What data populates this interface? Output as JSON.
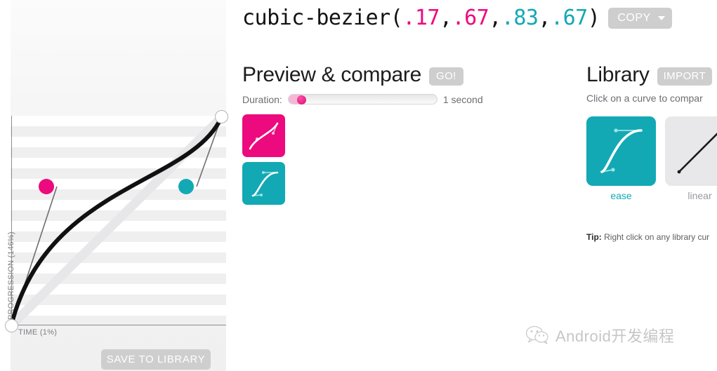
{
  "expression": {
    "prefix": "cubic-bezier(",
    "p1x": ".17",
    "sep1": ",",
    "p1y": ".67",
    "sep2": ",",
    "p2x": ".83",
    "sep3": ",",
    "p2y": ".67",
    "suffix": ")",
    "copy_label": "COPY",
    "caret_icon": "chevron-down-icon"
  },
  "editor": {
    "y_axis_label": "PROGRESSION (146%)",
    "x_axis_label": "TIME (1%)",
    "save_label": "SAVE TO LIBRARY",
    "handle1_color": "#ec0a7e",
    "handle2_color": "#12a9b4",
    "curve_color": "#111111",
    "ghost_curve_color": "#e4e4e6"
  },
  "preview": {
    "title": "Preview & compare",
    "go_label": "GO!",
    "duration_label": "Duration:",
    "duration_value": "1 second",
    "duration_percent": 8,
    "swatch_current_color": "#ec0a7e",
    "swatch_compare_color": "#12a9b4"
  },
  "library": {
    "title": "Library",
    "import_label": "IMPORT",
    "subtitle": "Click on a curve to compar",
    "tip_prefix": "Tip:",
    "tip_text": " Right click on any library cur",
    "items": [
      {
        "label": "ease",
        "selected": true,
        "thumb_bg": "#12a9b4",
        "curve_color": "#ffffff"
      },
      {
        "label": "linear",
        "selected": false,
        "thumb_bg": "#e8e8ea",
        "curve_color": "#1b1b1b"
      }
    ]
  },
  "watermark": {
    "icon": "wechat-icon",
    "text": "Android开发编程"
  },
  "chart_data": {
    "type": "line",
    "title": "cubic-bezier(.17,.67,.83,.67)",
    "xlabel": "TIME (1%)",
    "ylabel": "PROGRESSION (146%)",
    "control_points": {
      "p1x": 0.17,
      "p1y": 0.67,
      "p2x": 0.83,
      "p2y": 0.67
    },
    "start_point": [
      0,
      0
    ],
    "end_point": [
      1,
      1
    ],
    "xlim": [
      0,
      1
    ],
    "ylim": [
      0,
      1
    ],
    "grid": true,
    "reference_series": {
      "name": "linear",
      "x": [
        0,
        1
      ],
      "y": [
        0,
        1
      ]
    }
  }
}
